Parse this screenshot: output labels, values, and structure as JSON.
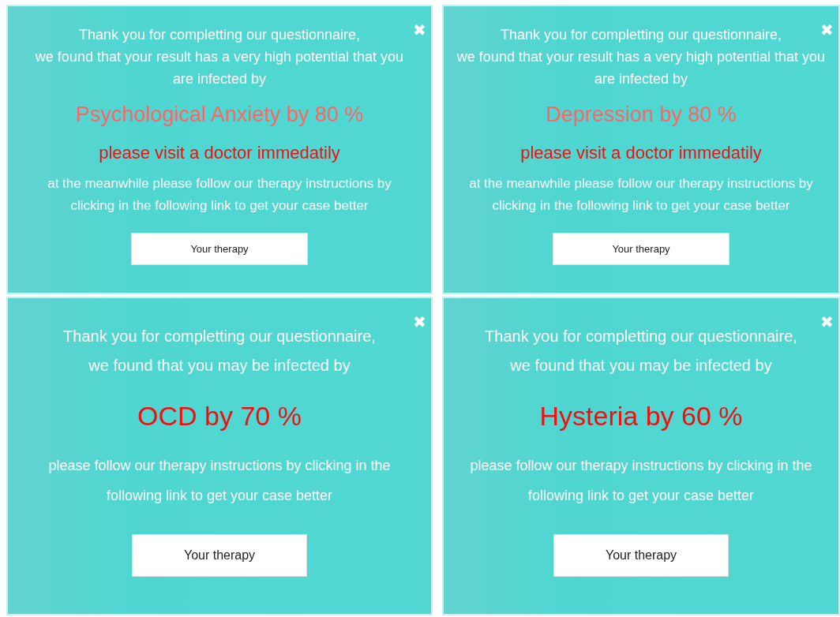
{
  "popups": [
    {
      "kind": "long",
      "close": "✖",
      "message": [
        "Thank you for completting our questionnaire,",
        "we found that your result has a very high potential that you",
        "are infected by"
      ],
      "result": "Psychological Anxiety by 80 %",
      "warning": "please visit a doctor immedatily",
      "instructions": [
        "at the meanwhile please follow our therapy instructions by",
        "clicking in the following link to get your case better"
      ],
      "button": "Your therapy"
    },
    {
      "kind": "long",
      "close": "✖",
      "message": [
        "Thank you for completting our questionnaire,",
        "we found that your result has a very high potential that you",
        "are infected by"
      ],
      "result": "Depression by 80 %",
      "warning": "please visit a doctor immedatily",
      "instructions": [
        "at the meanwhile please follow our therapy instructions by",
        "clicking in the following link to get your case better"
      ],
      "button": "Your therapy"
    },
    {
      "kind": "short",
      "close": "✖",
      "message": [
        "Thank you for completting our questionnaire,",
        "we found that you may be infected by"
      ],
      "result": "OCD by 70 %",
      "instructions": [
        "please follow our therapy instructions by clicking in the",
        "following link to get your case better"
      ],
      "button": "Your therapy"
    },
    {
      "kind": "short",
      "close": "✖",
      "message": [
        "Thank you for completting our questionnaire,",
        "we found that you may be infected by"
      ],
      "result": "Hysteria by 60 %",
      "instructions": [
        "please follow our therapy instructions by clicking in the",
        "following link to get your case better"
      ],
      "button": "Your therapy"
    }
  ]
}
